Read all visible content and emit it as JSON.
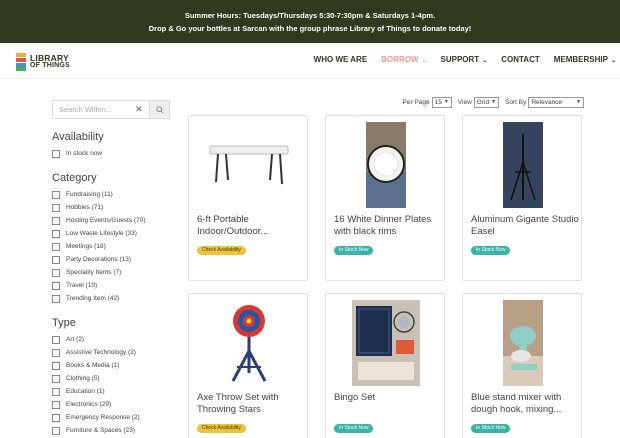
{
  "announcement": {
    "line1": "Summer Hours: Tuesdays/Thursdays 5:30-7:30pm & Saturdays 1-4pm.",
    "line2": "Drop & Go your bottles at Sarcan with the group phrase Library of Things to donate today!"
  },
  "brand": {
    "line1": "LIBRARY",
    "line2": "OF THINGS",
    "colors": [
      "#f2b230",
      "#e0564a",
      "#4a8fd0",
      "#4caf50"
    ]
  },
  "nav": [
    {
      "label": "WHO WE ARE",
      "dropdown": false,
      "active": false
    },
    {
      "label": "BORROW",
      "dropdown": true,
      "active": true
    },
    {
      "label": "SUPPORT",
      "dropdown": true,
      "active": false
    },
    {
      "label": "CONTACT",
      "dropdown": false,
      "active": false
    },
    {
      "label": "MEMBERSHIP",
      "dropdown": true,
      "active": false
    }
  ],
  "search": {
    "placeholder": "Search Within..."
  },
  "filters": {
    "availability": {
      "title": "Availability",
      "options": [
        "In stock now"
      ]
    },
    "category": {
      "title": "Category",
      "options": [
        "Fundraising (11)",
        "Hobbies (71)",
        "Hosting Events/Guests (70)",
        "Low Waste Lifestyle (33)",
        "Meetings (18)",
        "Party Decorations (13)",
        "Speciality Items (7)",
        "Travel (19)",
        "Trending Item (42)"
      ]
    },
    "type": {
      "title": "Type",
      "options": [
        "Art (2)",
        "Assistive Technology (2)",
        "Books & Media (1)",
        "Clothing (5)",
        "Education (1)",
        "Electronics (29)",
        "Emergency Response (2)",
        "Furniture & Spaces (23)"
      ]
    }
  },
  "controls": {
    "per_page_label": "Per Page",
    "per_page_value": "15",
    "view_label": "View",
    "view_value": "Grid",
    "sort_label": "Sort By",
    "sort_value": "Relevance"
  },
  "products": [
    {
      "name": "6-ft Portable Indoor/Outdoor...",
      "status": "Check Availability",
      "status_color": "yellow",
      "icon": "folding-table-image"
    },
    {
      "name": "16 White Dinner Plates with black rims",
      "status": "In Stock Now",
      "status_color": "teal",
      "icon": "dinner-plates-image"
    },
    {
      "name": "Aluminum Gigante Studio Easel",
      "status": "In Stock Now",
      "status_color": "teal",
      "icon": "easel-image"
    },
    {
      "name": "Axe Throw Set with Throwing Stars",
      "status": "Check Availability",
      "status_color": "yellow",
      "icon": "axe-throw-target-image"
    },
    {
      "name": "Bingo Set",
      "status": "In Stock Now",
      "status_color": "teal",
      "icon": "bingo-set-image"
    },
    {
      "name": "Blue stand mixer with dough hook, mixing...",
      "status": "In Stock Now",
      "status_color": "teal",
      "icon": "stand-mixer-image"
    }
  ]
}
